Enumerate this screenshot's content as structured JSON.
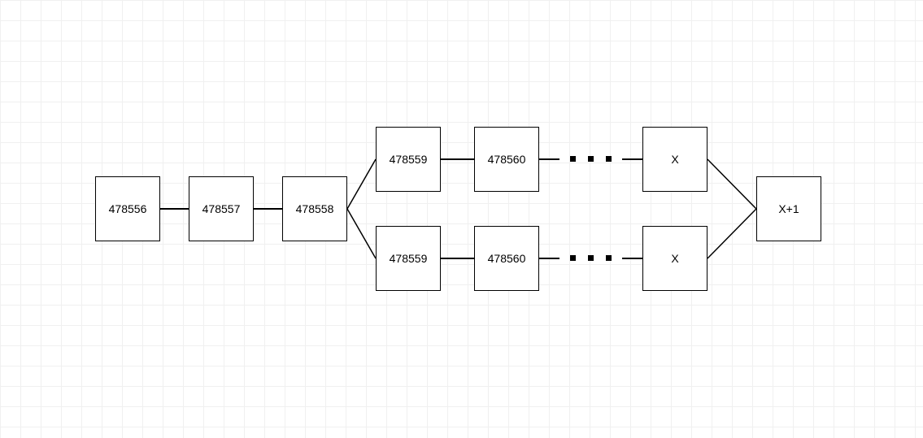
{
  "nodes": {
    "n1": "478556",
    "n2": "478557",
    "n3": "478558",
    "n4_top": "478559",
    "n5_top": "478560",
    "n6_top": "X",
    "n4_bot": "478559",
    "n5_bot": "478560",
    "n6_bot": "X",
    "n7": "X+1"
  },
  "layout": {
    "ellipsis": "dots"
  }
}
